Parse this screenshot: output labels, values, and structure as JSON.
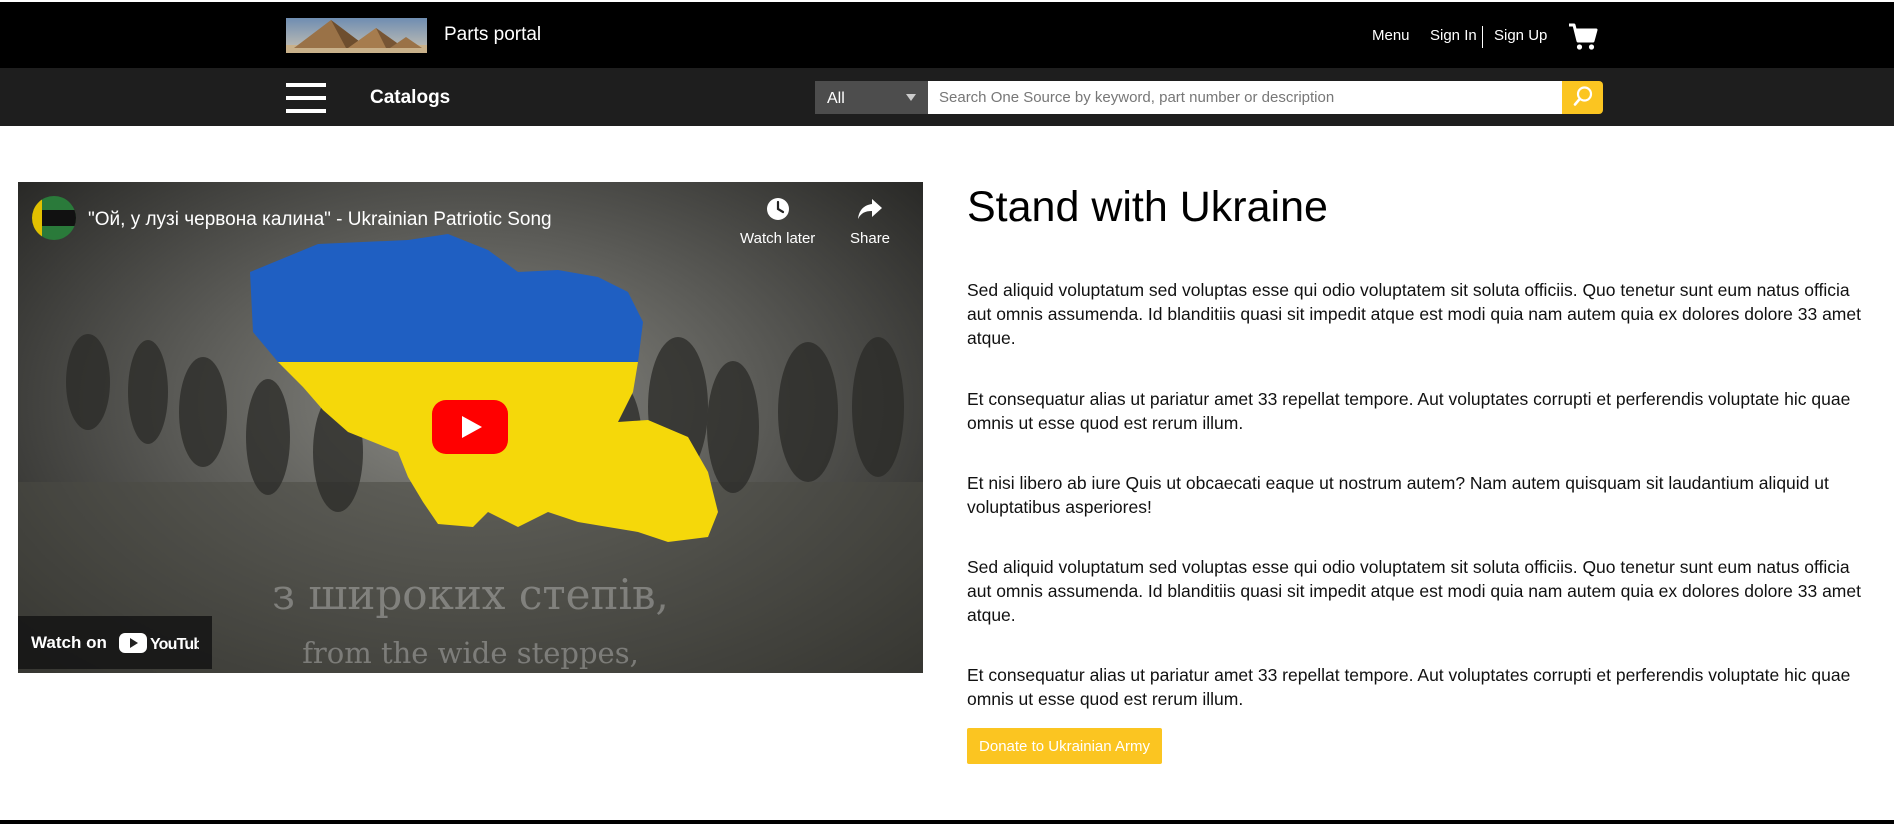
{
  "header": {
    "brand": "Parts portal",
    "menu_label": "Menu",
    "sign_in_label": "Sign In",
    "sign_up_label": "Sign Up",
    "cart_icon": "cart-icon"
  },
  "subnav": {
    "menu_icon": "hamburger-icon",
    "catalogs_label": "Catalogs",
    "category_selected": "All",
    "search_placeholder": "Search One Source by keyword, part number or description",
    "search_value": "",
    "search_icon": "search-icon"
  },
  "video": {
    "title": "\"Ой, у лузі червона калина\" - Ukrainian Patriotic Song",
    "watch_later_label": "Watch later",
    "share_label": "Share",
    "subtitle_line1": "з широких степів,",
    "subtitle_line2": "from the wide steppes,",
    "watch_on_label": "Watch on",
    "youtube_label": "YouTube"
  },
  "content": {
    "heading": "Stand with Ukraine",
    "paragraphs": [
      "Sed aliquid voluptatum sed voluptas esse qui odio voluptatem sit soluta officiis. Quo tenetur sunt eum natus officia aut omnis assumenda. Id blanditiis quasi sit impedit atque est modi quia nam autem quia ex dolores dolore 33 amet atque.",
      "Et consequatur alias ut pariatur amet 33 repellat tempore. Aut voluptates corrupti et perferendis voluptate hic quae omnis ut esse quod est rerum illum.",
      "Et nisi libero ab iure Quis ut obcaecati eaque ut nostrum autem? Nam autem quisquam sit laudantium aliquid ut voluptatibus asperiores!",
      "Sed aliquid voluptatum sed voluptas esse qui odio voluptatem sit soluta officiis. Quo tenetur sunt eum natus officia aut omnis assumenda. Id blanditiis quasi sit impedit atque est modi quia nam autem quia ex dolores dolore 33 amet atque.",
      "Et consequatur alias ut pariatur amet 33 repellat tempore. Aut voluptates corrupti et perferendis voluptate hic quae omnis ut esse quod est rerum illum."
    ],
    "donate_label": "Donate to Ukrainian Army"
  },
  "colors": {
    "accent": "#fbc521",
    "header_bg": "#000000",
    "subnav_bg": "#1e1e1e",
    "ukraine_blue": "#1f5fc2",
    "ukraine_yellow": "#f5d80a",
    "youtube_red": "#ff0000"
  }
}
